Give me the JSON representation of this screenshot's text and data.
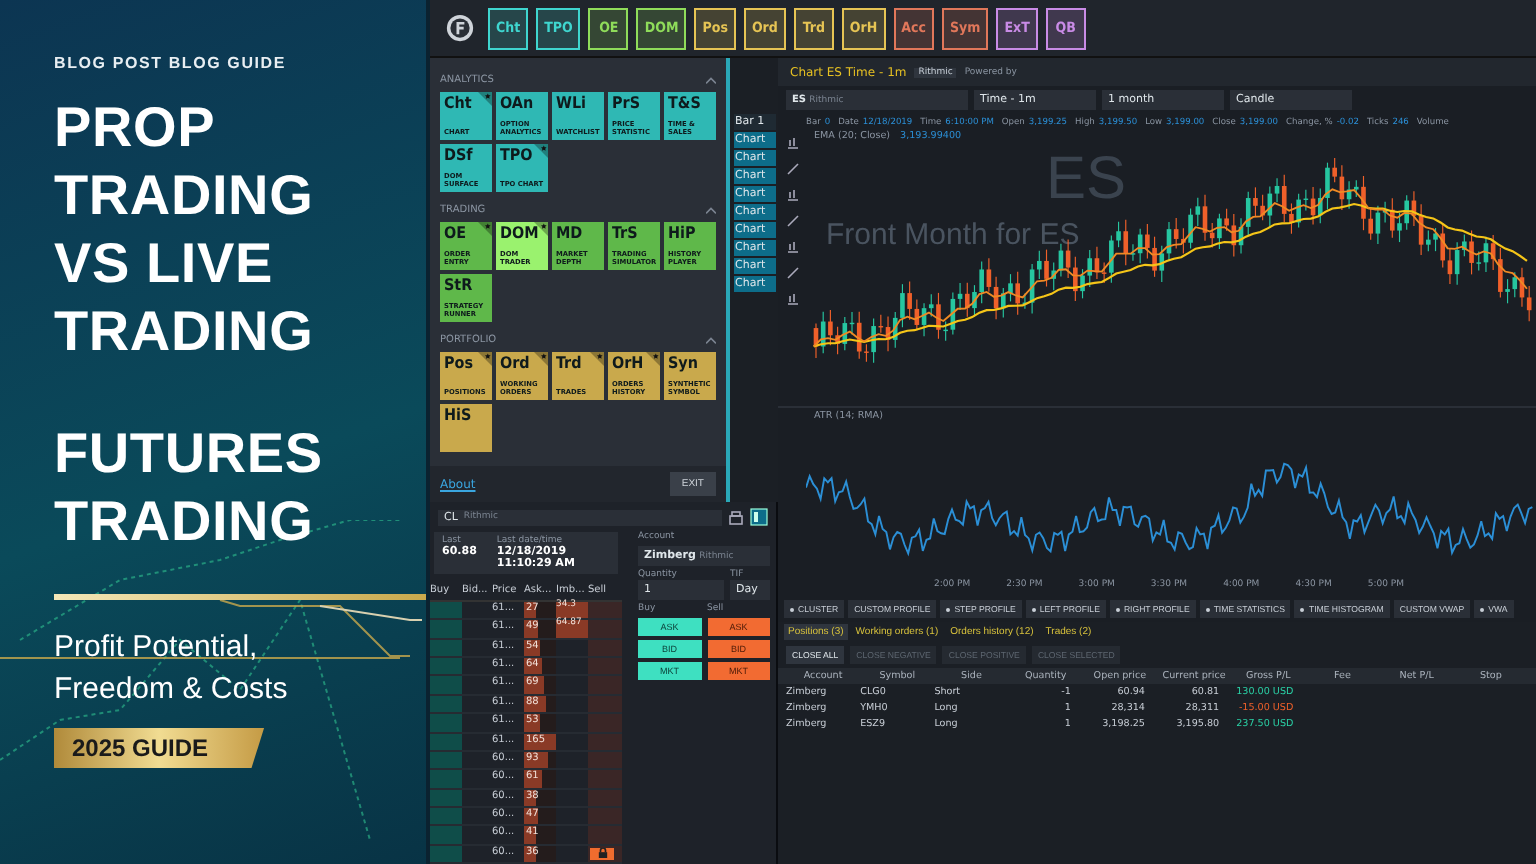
{
  "article": {
    "kicker": "BLOG POST BLOG GUIDE",
    "title_lines": [
      "PROP",
      "TRADING",
      "VS LIVE",
      "TRADING"
    ],
    "subtitle_lines": [
      "FUTURES",
      "TRADING"
    ],
    "tagline_lines": [
      "Profit Potential,",
      "Freedom & Costs"
    ],
    "badge": "2025 GUIDE"
  },
  "toolbar": {
    "tiles": [
      {
        "label": "Cht",
        "color": "#3fd6cf"
      },
      {
        "label": "TPO",
        "color": "#3fd6cf"
      },
      {
        "label": "OE",
        "color": "#8fdc5a"
      },
      {
        "label": "DOM",
        "color": "#8fdc5a"
      },
      {
        "label": "Pos",
        "color": "#e6c454"
      },
      {
        "label": "Ord",
        "color": "#e6c454"
      },
      {
        "label": "Trd",
        "color": "#e6c454"
      },
      {
        "label": "OrH",
        "color": "#e6c454"
      },
      {
        "label": "Acc",
        "color": "#e0775a"
      },
      {
        "label": "Sym",
        "color": "#e0775a"
      },
      {
        "label": "ExT",
        "color": "#c98be6"
      },
      {
        "label": "QB",
        "color": "#c98be6"
      }
    ]
  },
  "module_menu": {
    "sections": [
      {
        "title": "ANALYTICS",
        "color": "#2fb8b4",
        "tiles": [
          {
            "abbr": "Cht",
            "name": "CHART",
            "favorite": true,
            "selected": false
          },
          {
            "abbr": "OAn",
            "name": "OPTION ANALYTICS",
            "favorite": false,
            "selected": false
          },
          {
            "abbr": "WLi",
            "name": "WATCHLIST",
            "favorite": false,
            "selected": false
          },
          {
            "abbr": "PrS",
            "name": "PRICE STATISTIC",
            "favorite": false,
            "selected": false
          },
          {
            "abbr": "T&S",
            "name": "TIME & SALES",
            "favorite": false,
            "selected": false
          },
          {
            "abbr": "DSf",
            "name": "DOM SURFACE",
            "favorite": false,
            "selected": false
          },
          {
            "abbr": "TPO",
            "name": "TPO CHART",
            "favorite": true,
            "selected": false
          }
        ]
      },
      {
        "title": "TRADING",
        "color": "#5fb84a",
        "tiles": [
          {
            "abbr": "OE",
            "name": "ORDER ENTRY",
            "favorite": true,
            "selected": false
          },
          {
            "abbr": "DOM",
            "name": "DOM TRADER",
            "favorite": true,
            "selected": true
          },
          {
            "abbr": "MD",
            "name": "MARKET DEPTH",
            "favorite": false,
            "selected": false
          },
          {
            "abbr": "TrS",
            "name": "TRADING SIMULATOR",
            "favorite": false,
            "selected": false
          },
          {
            "abbr": "HiP",
            "name": "HISTORY PLAYER",
            "favorite": false,
            "selected": false
          },
          {
            "abbr": "StR",
            "name": "STRATEGY RUNNER",
            "favorite": false,
            "selected": false
          }
        ]
      },
      {
        "title": "PORTFOLIO",
        "color": "#c9a94c",
        "tiles": [
          {
            "abbr": "Pos",
            "name": "POSITIONS",
            "favorite": true,
            "selected": false
          },
          {
            "abbr": "Ord",
            "name": "WORKING ORDERS",
            "favorite": true,
            "selected": false
          },
          {
            "abbr": "Trd",
            "name": "TRADES",
            "favorite": true,
            "selected": false
          },
          {
            "abbr": "OrH",
            "name": "ORDERS HISTORY",
            "favorite": true,
            "selected": false
          },
          {
            "abbr": "Syn",
            "name": "SYNTHETIC SYMBOL",
            "favorite": false,
            "selected": false
          },
          {
            "abbr": "HiS",
            "favorite": false,
            "selected": false
          }
        ]
      }
    ],
    "about": "About",
    "exit": "EXIT"
  },
  "side_list": {
    "header": "Bar 1",
    "items": [
      "Chart",
      "Chart",
      "Chart",
      "Chart",
      "Chart",
      "Chart",
      "Chart",
      "Chart",
      "Chart"
    ]
  },
  "chart_window": {
    "title": "Chart ES Time - 1m",
    "feed": "Rithmic",
    "powered": "Powered by",
    "symbol": "ES",
    "symbol_feed": "Rithmic",
    "period": "Time - 1m",
    "range": "1 month",
    "style": "Candle",
    "info": [
      {
        "label": "Bar",
        "value": "0"
      },
      {
        "label": "Date",
        "value": "12/18/2019"
      },
      {
        "label": "Time",
        "value": "6:10:00 PM"
      },
      {
        "label": "Open",
        "value": "3,199.25"
      },
      {
        "label": "High",
        "value": "3,199.50"
      },
      {
        "label": "Low",
        "value": "3,199.00"
      },
      {
        "label": "Close",
        "value": "3,199.00"
      },
      {
        "label": "Change, %",
        "value": "-0.02"
      },
      {
        "label": "Ticks",
        "value": "246"
      },
      {
        "label": "Volume"
      }
    ],
    "ema_label": "EMA (20; Close)",
    "ema_value": "3,193.99400",
    "watermark": "ES",
    "watermark_sub": "Front Month for ES",
    "atr_label": "ATR (14; RMA)",
    "time_ticks": [
      "2:00 PM",
      "2:30 PM",
      "3:00 PM",
      "3:30 PM",
      "4:00 PM",
      "4:30 PM",
      "5:00 PM"
    ],
    "profiles": [
      {
        "label": "CLUSTER",
        "on": true
      },
      {
        "label": "CUSTOM PROFILE",
        "on": false
      },
      {
        "label": "STEP PROFILE",
        "on": true
      },
      {
        "label": "LEFT PROFILE",
        "on": true
      },
      {
        "label": "RIGHT PROFILE",
        "on": true
      },
      {
        "label": "TIME STATISTICS",
        "on": true
      },
      {
        "label": "TIME HISTOGRAM",
        "on": true
      },
      {
        "label": "CUSTOM VWAP",
        "on": false
      },
      {
        "label": "VWA",
        "on": true
      }
    ]
  },
  "positions": {
    "tabs": [
      {
        "label": "Positions (3)",
        "selected": true
      },
      {
        "label": "Working orders (1)",
        "selected": false
      },
      {
        "label": "Orders history (12)",
        "selected": false
      },
      {
        "label": "Trades (2)",
        "selected": false
      }
    ],
    "actions": [
      {
        "label": "CLOSE ALL",
        "disabled": false
      },
      {
        "label": "CLOSE NEGATIVE",
        "disabled": true
      },
      {
        "label": "CLOSE POSITIVE",
        "disabled": true
      },
      {
        "label": "CLOSE SELECTED",
        "disabled": true
      }
    ],
    "columns": [
      "Account",
      "Symbol",
      "Side",
      "Quantity",
      "Open price",
      "Current price",
      "Gross P/L",
      "Fee",
      "Net P/L",
      "Stop"
    ],
    "rows": [
      {
        "account": "Zimberg",
        "symbol": "CLG0",
        "side": "Short",
        "quantity": "-1",
        "open": "60.94",
        "current": "60.81",
        "gross": "130.00 USD",
        "gain": true
      },
      {
        "account": "Zimberg",
        "symbol": "YMH0",
        "side": "Long",
        "quantity": "1",
        "open": "28,314",
        "current": "28,311",
        "gross": "-15.00 USD",
        "gain": false
      },
      {
        "account": "Zimberg",
        "symbol": "ESZ9",
        "side": "Long",
        "quantity": "1",
        "open": "3,198.25",
        "current": "3,195.80",
        "gross": "237.50 USD",
        "gain": true
      }
    ]
  },
  "dom": {
    "symbol": "CL",
    "symbol_feed": "Rithmic",
    "last_label": "Last",
    "last": "60.88",
    "time_label": "Last date/time",
    "time": "12/18/2019 11:10:29 AM",
    "columns": [
      "Buy",
      "Bid...",
      "Price",
      "Ask...",
      "Imb...",
      "Sell"
    ],
    "rows": [
      {
        "price": "61...",
        "ask": "27",
        "level": 0.35,
        "imb": "34.3",
        "order": false
      },
      {
        "price": "61...",
        "ask": "49",
        "level": 0.45,
        "imb": "64.87",
        "order": false
      },
      {
        "price": "61...",
        "ask": "54",
        "level": 0.5,
        "order": false
      },
      {
        "price": "61...",
        "ask": "64",
        "level": 0.55,
        "order": false
      },
      {
        "price": "61...",
        "ask": "69",
        "level": 0.6,
        "order": false
      },
      {
        "price": "61...",
        "ask": "88",
        "level": 0.7,
        "order": false
      },
      {
        "price": "61...",
        "ask": "53",
        "level": 0.5,
        "order": false
      },
      {
        "price": "61...",
        "ask": "165",
        "level": 1,
        "order": false
      },
      {
        "price": "60...",
        "ask": "93",
        "level": 0.75,
        "order": false
      },
      {
        "price": "60...",
        "ask": "61",
        "level": 0.55,
        "order": false
      },
      {
        "price": "60...",
        "ask": "38",
        "level": 0.4,
        "order": false
      },
      {
        "price": "60...",
        "ask": "47",
        "level": 0.45,
        "order": false
      },
      {
        "price": "60...",
        "ask": "41",
        "level": 0.4,
        "order": false
      },
      {
        "price": "60...",
        "ask": "36",
        "level": 0.4,
        "order": true
      }
    ],
    "account_label": "Account",
    "account": "Zimberg",
    "account_feed": "Rithmic",
    "quantity_label": "Quantity",
    "quantity": "1",
    "tif_label": "TIF",
    "tif": "Day",
    "buy_label": "Buy",
    "sell_label": "Sell",
    "buy_buttons": [
      "ASK",
      "BID",
      "MKT"
    ],
    "sell_buttons": [
      "ASK",
      "BID",
      "MKT"
    ]
  }
}
